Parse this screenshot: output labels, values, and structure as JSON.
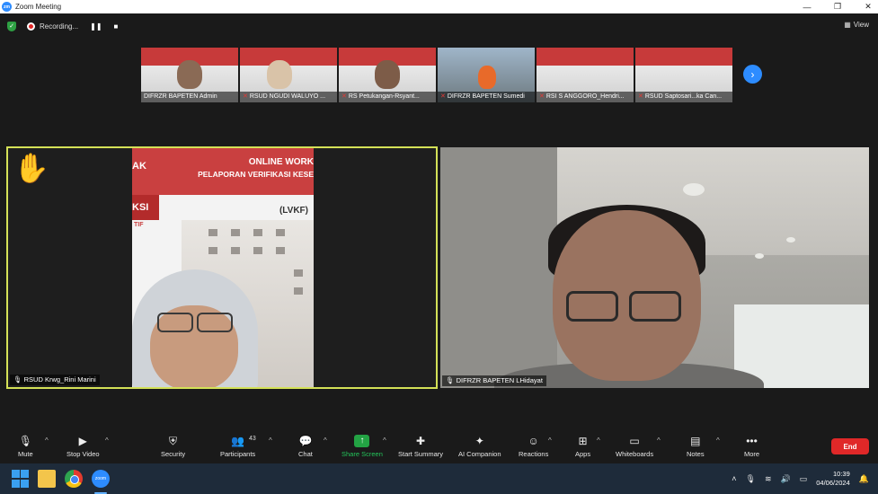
{
  "window": {
    "title": "Zoom Meeting",
    "controls": [
      "—",
      "❐",
      "✕"
    ]
  },
  "topbar": {
    "recording_label": "Recording...",
    "pause_icon": "pause-icon",
    "stop_icon": "stop-icon",
    "view_label": "View"
  },
  "thumbnails": [
    {
      "name": "DIFRZR BAPETEN Admin",
      "muted": false,
      "kind": "slide-face"
    },
    {
      "name": "RSUD NGUDI WALUYO ...",
      "muted": true,
      "kind": "slide-face"
    },
    {
      "name": "RS Petukangan-Rsyant...",
      "muted": true,
      "kind": "slide-face"
    },
    {
      "name": "DIFRZR BAPETEN Sumedi",
      "muted": true,
      "kind": "outdoor"
    },
    {
      "name": "RSI S ANGGORO_Hendri...",
      "muted": true,
      "kind": "slide"
    },
    {
      "name": "RSUD Saptosari...ka Can...",
      "muted": true,
      "kind": "slide"
    }
  ],
  "main_tiles": [
    {
      "name": "RSUD Krwg_Rini Marini",
      "reaction": "✋",
      "slide_title_1": "ONLINE WORK",
      "slide_title_2": "PELAPORAN VERIFIKASI KESE",
      "slide_title_3": "(LVKF)",
      "slide_fragment_1": "AK",
      "slide_fragment_2": "KSI",
      "slide_fragment_3": "TIF"
    },
    {
      "name": "DIFRZR BAPETEN LHidayat"
    }
  ],
  "toolbar": {
    "mute": "Mute",
    "stop_video": "Stop Video",
    "security": "Security",
    "participants": "Participants",
    "participants_count": "43",
    "chat": "Chat",
    "share_screen": "Share Screen",
    "start_summary": "Start Summary",
    "ai_companion": "AI Companion",
    "reactions": "Reactions",
    "apps": "Apps",
    "whiteboards": "Whiteboards",
    "notes": "Notes",
    "more": "More",
    "end": "End"
  },
  "taskbar": {
    "time": "10:39",
    "date": "04/06/2024"
  },
  "colors": {
    "active_speaker_border": "#d4e157",
    "end_red": "#e02828",
    "zoom_blue": "#2d8cff",
    "share_green": "#23a344"
  }
}
